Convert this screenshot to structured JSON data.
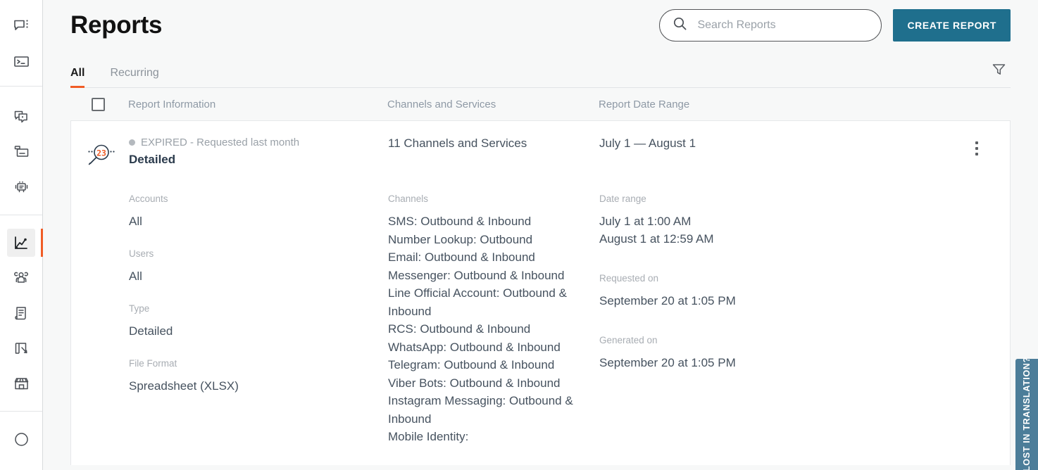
{
  "sidebar": {
    "groups": [
      {
        "items": [
          {
            "name": "conversations-icon",
            "label": "Conversations",
            "active": false
          },
          {
            "name": "console-icon",
            "label": "Console",
            "active": false
          }
        ]
      },
      {
        "items": [
          {
            "name": "campaigns-icon",
            "label": "Campaigns",
            "active": false
          },
          {
            "name": "inbox-icon",
            "label": "Inbox",
            "active": false
          },
          {
            "name": "bot-icon",
            "label": "Bots",
            "active": false
          }
        ]
      },
      {
        "items": [
          {
            "name": "analytics-icon",
            "label": "Analytics",
            "active": true
          },
          {
            "name": "contacts-icon",
            "label": "Contacts",
            "active": false
          },
          {
            "name": "journal-icon",
            "label": "Journal",
            "active": false
          },
          {
            "name": "flow-icon",
            "label": "Flow Builder",
            "active": false
          },
          {
            "name": "store-icon",
            "label": "Store",
            "active": false
          }
        ]
      },
      {
        "items": [
          {
            "name": "help-icon",
            "label": "Help",
            "active": false
          }
        ]
      }
    ]
  },
  "header": {
    "title": "Reports",
    "search": {
      "placeholder": "Search Reports",
      "value": ""
    },
    "create_button": "CREATE REPORT",
    "accent_color": "#1f6f8d"
  },
  "tabs": {
    "items": [
      {
        "label": "All",
        "active": true
      },
      {
        "label": "Recurring",
        "active": false
      }
    ],
    "active_underline_color": "#f05c26",
    "filter_icon": "filter-funnel-icon"
  },
  "table": {
    "columns": [
      {
        "key": "report_information",
        "label": "Report Information"
      },
      {
        "key": "channels_and_services",
        "label": "Channels and Services"
      },
      {
        "key": "report_date_range",
        "label": "Report Date Range"
      }
    ],
    "select_all_checked": false
  },
  "report": {
    "badge_icon": "magnifier-23-icon",
    "badge_number": "23",
    "status_dot_color": "#b4b9be",
    "status": "EXPIRED - Requested last month",
    "name": "Detailed",
    "channels_summary": "11 Channels and Services",
    "date_range_summary": "July 1 — August 1",
    "info_fields": [
      {
        "label": "Accounts",
        "value": "All"
      },
      {
        "label": "Users",
        "value": "All"
      },
      {
        "label": "Type",
        "value": "Detailed"
      },
      {
        "label": "File Format",
        "value": "Spreadsheet (XLSX)"
      }
    ],
    "channels": {
      "label": "Channels",
      "lines": [
        "SMS: Outbound & Inbound",
        "Number Lookup: Outbound",
        "Email: Outbound & Inbound",
        "Messenger: Outbound & Inbound",
        "Line Official Account: Outbound & Inbound",
        "RCS: Outbound & Inbound",
        "WhatsApp: Outbound & Inbound",
        "Telegram: Outbound & Inbound",
        "Viber Bots: Outbound & Inbound",
        "Instagram Messaging: Outbound & Inbound",
        "Mobile Identity:"
      ]
    },
    "date_fields": [
      {
        "label": "Date range",
        "lines": [
          "July 1 at 1:00 AM",
          "August 1 at 12:59 AM"
        ]
      },
      {
        "label": "Requested on",
        "lines": [
          "September 20 at 1:05 PM"
        ]
      },
      {
        "label": "Generated on",
        "lines": [
          "September 20 at 1:05 PM"
        ]
      }
    ],
    "row_menu_icon": "kebab-menu-icon"
  },
  "translation_widget": {
    "label": "LOST IN TRANSLATION?",
    "color": "#4c7d99"
  }
}
